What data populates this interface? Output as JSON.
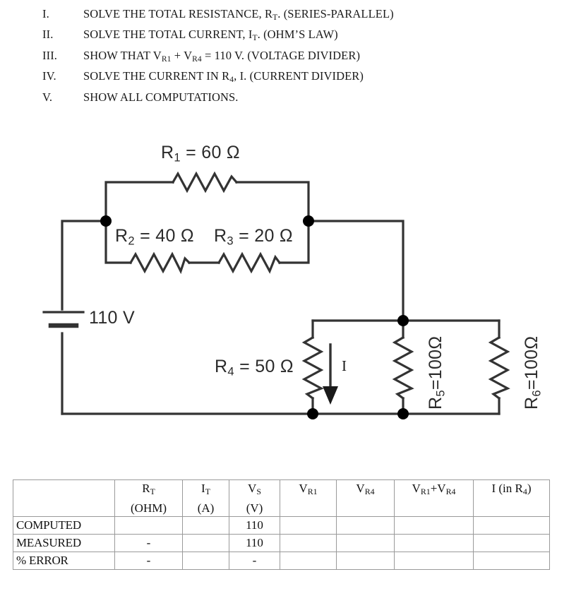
{
  "instructions": [
    {
      "num": "I.",
      "text": "SOLVE THE TOTAL RESISTANCE, R<sub>T</sub>. (SERIES-PARALLEL)"
    },
    {
      "num": "II.",
      "text": "SOLVE THE  TOTAL CURRENT, I<sub>T</sub>. (OHM&rsquo;S LAW)"
    },
    {
      "num": "III.",
      "text": "SHOW THAT V<sub>R1</sub> + V<sub>R4</sub> = 110 V. (VOLTAGE DIVIDER)"
    },
    {
      "num": "IV.",
      "text": "SOLVE THE CURRENT IN R<sub>4</sub>, I. (CURRENT DIVIDER)"
    },
    {
      "num": "V.",
      "text": "SHOW ALL COMPUTATIONS."
    }
  ],
  "circuit": {
    "source_label": "110 V",
    "current_label": "I",
    "r1_label": "R<sub>1</sub> = 60 &Omega;",
    "r2_label": "R<sub>2</sub> = 40 &Omega;",
    "r3_label": "R<sub>3</sub> = 20 &Omega;",
    "r4_label": "R<sub>4</sub> = 50 &Omega;",
    "r5_label": "R<sub>5</sub>=100&Omega;",
    "r6_label": "R<sub>6</sub>=100&Omega;",
    "components": [
      {
        "name": "R1",
        "value": 60,
        "unit": "ohm"
      },
      {
        "name": "R2",
        "value": 40,
        "unit": "ohm"
      },
      {
        "name": "R3",
        "value": 20,
        "unit": "ohm"
      },
      {
        "name": "R4",
        "value": 50,
        "unit": "ohm"
      },
      {
        "name": "R5",
        "value": 100,
        "unit": "ohm"
      },
      {
        "name": "R6",
        "value": 100,
        "unit": "ohm"
      },
      {
        "name": "Vs",
        "value": 110,
        "unit": "volt"
      }
    ],
    "wire_color": "#333333",
    "node_color": "#000000"
  },
  "table": {
    "headers": [
      {
        "top": "",
        "bot": ""
      },
      {
        "top": "R<sub>T</sub>",
        "bot": "(OHM)"
      },
      {
        "top": "I<sub>T</sub>",
        "bot": "(A)"
      },
      {
        "top": "V<sub>S</sub>",
        "bot": "(V)"
      },
      {
        "top": "V<sub>R1</sub>",
        "bot": ""
      },
      {
        "top": "V<sub>R4</sub>",
        "bot": ""
      },
      {
        "top": "V<sub>R1</sub>+V<sub>R4</sub>",
        "bot": ""
      },
      {
        "top": "I (in R<sub>4</sub>)",
        "bot": ""
      }
    ],
    "rows": [
      {
        "label": "COMPUTED",
        "cells": [
          "",
          "",
          "110",
          "",
          "",
          "",
          ""
        ]
      },
      {
        "label": "MEASURED",
        "cells": [
          "-",
          "",
          "110",
          "",
          "",
          "",
          ""
        ]
      },
      {
        "label": "% ERROR",
        "cells": [
          "-",
          "",
          "-",
          "",
          "",
          "",
          ""
        ]
      }
    ]
  }
}
